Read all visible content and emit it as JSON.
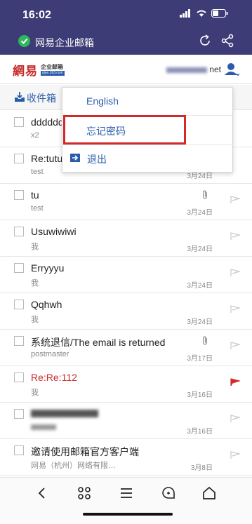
{
  "status_bar": {
    "time": "16:02"
  },
  "browser": {
    "site_title": "网易企业邮箱"
  },
  "app_header": {
    "logo_main": "網易",
    "logo_sub_top": "企业邮箱",
    "logo_sub_bottom": "qiye.163.com",
    "account_suffix": "net"
  },
  "toolbar": {
    "folder_label": "收件箱"
  },
  "dropdown": {
    "items": [
      {
        "label": "English"
      },
      {
        "label": "忘记密码"
      },
      {
        "label": "退出"
      }
    ]
  },
  "mails": [
    {
      "subject": "dddddd",
      "sender": "x2",
      "date": "",
      "attachment": false,
      "flag": "none",
      "unread_color": "#222222"
    },
    {
      "subject": "Re:tutu",
      "sender": "test",
      "date": "3月24日",
      "attachment": false,
      "flag": "none",
      "unread_color": "#222222"
    },
    {
      "subject": "tu",
      "sender": "test",
      "date": "3月24日",
      "attachment": true,
      "flag": "outline",
      "unread_color": "#222222"
    },
    {
      "subject": "Usuwiwiwi",
      "sender": "我",
      "date": "3月24日",
      "attachment": false,
      "flag": "outline",
      "unread_color": "#222222"
    },
    {
      "subject": "Erryyyu",
      "sender": "我",
      "date": "3月24日",
      "attachment": false,
      "flag": "outline",
      "unread_color": "#222222"
    },
    {
      "subject": "Qqhwh",
      "sender": "我",
      "date": "3月24日",
      "attachment": false,
      "flag": "outline",
      "unread_color": "#222222"
    },
    {
      "subject": "系统退信/The email is returned",
      "sender": "postmaster",
      "date": "3月17日",
      "attachment": true,
      "flag": "outline",
      "unread_color": "#222222"
    },
    {
      "subject": "Re:Re:112",
      "sender": "我",
      "date": "3月16日",
      "attachment": false,
      "flag": "red",
      "unread_color": "#d02a2a"
    },
    {
      "subject": "",
      "sender": "",
      "date": "3月16日",
      "attachment": false,
      "flag": "outline",
      "unread_color": "#222222"
    },
    {
      "subject": "邀请使用邮箱官方客户端",
      "sender": "网易（杭州）网络有限…",
      "date": "3月8日",
      "attachment": false,
      "flag": "outline",
      "unread_color": "#222222"
    }
  ],
  "bottom_nav": {
    "buttons": [
      "back",
      "apps",
      "menu",
      "ai",
      "home"
    ]
  },
  "colors": {
    "header_bg": "#3e3c76",
    "accent": "#2a5caa",
    "alert": "#d22a2a"
  }
}
